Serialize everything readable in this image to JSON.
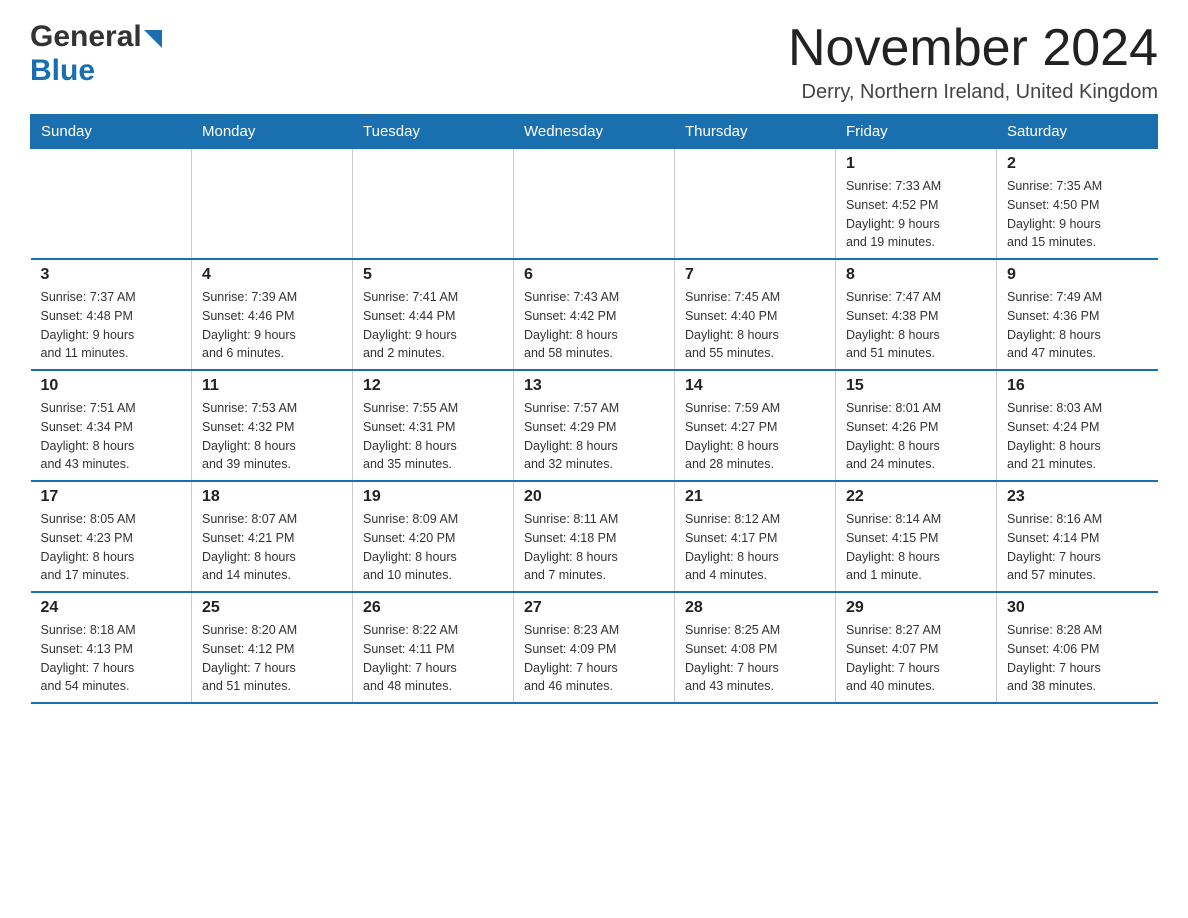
{
  "header": {
    "logo_general": "General",
    "logo_blue": "Blue",
    "month_title": "November 2024",
    "location": "Derry, Northern Ireland, United Kingdom"
  },
  "days_of_week": [
    "Sunday",
    "Monday",
    "Tuesday",
    "Wednesday",
    "Thursday",
    "Friday",
    "Saturday"
  ],
  "weeks": [
    [
      {
        "day": "",
        "info": ""
      },
      {
        "day": "",
        "info": ""
      },
      {
        "day": "",
        "info": ""
      },
      {
        "day": "",
        "info": ""
      },
      {
        "day": "",
        "info": ""
      },
      {
        "day": "1",
        "info": "Sunrise: 7:33 AM\nSunset: 4:52 PM\nDaylight: 9 hours\nand 19 minutes."
      },
      {
        "day": "2",
        "info": "Sunrise: 7:35 AM\nSunset: 4:50 PM\nDaylight: 9 hours\nand 15 minutes."
      }
    ],
    [
      {
        "day": "3",
        "info": "Sunrise: 7:37 AM\nSunset: 4:48 PM\nDaylight: 9 hours\nand 11 minutes."
      },
      {
        "day": "4",
        "info": "Sunrise: 7:39 AM\nSunset: 4:46 PM\nDaylight: 9 hours\nand 6 minutes."
      },
      {
        "day": "5",
        "info": "Sunrise: 7:41 AM\nSunset: 4:44 PM\nDaylight: 9 hours\nand 2 minutes."
      },
      {
        "day": "6",
        "info": "Sunrise: 7:43 AM\nSunset: 4:42 PM\nDaylight: 8 hours\nand 58 minutes."
      },
      {
        "day": "7",
        "info": "Sunrise: 7:45 AM\nSunset: 4:40 PM\nDaylight: 8 hours\nand 55 minutes."
      },
      {
        "day": "8",
        "info": "Sunrise: 7:47 AM\nSunset: 4:38 PM\nDaylight: 8 hours\nand 51 minutes."
      },
      {
        "day": "9",
        "info": "Sunrise: 7:49 AM\nSunset: 4:36 PM\nDaylight: 8 hours\nand 47 minutes."
      }
    ],
    [
      {
        "day": "10",
        "info": "Sunrise: 7:51 AM\nSunset: 4:34 PM\nDaylight: 8 hours\nand 43 minutes."
      },
      {
        "day": "11",
        "info": "Sunrise: 7:53 AM\nSunset: 4:32 PM\nDaylight: 8 hours\nand 39 minutes."
      },
      {
        "day": "12",
        "info": "Sunrise: 7:55 AM\nSunset: 4:31 PM\nDaylight: 8 hours\nand 35 minutes."
      },
      {
        "day": "13",
        "info": "Sunrise: 7:57 AM\nSunset: 4:29 PM\nDaylight: 8 hours\nand 32 minutes."
      },
      {
        "day": "14",
        "info": "Sunrise: 7:59 AM\nSunset: 4:27 PM\nDaylight: 8 hours\nand 28 minutes."
      },
      {
        "day": "15",
        "info": "Sunrise: 8:01 AM\nSunset: 4:26 PM\nDaylight: 8 hours\nand 24 minutes."
      },
      {
        "day": "16",
        "info": "Sunrise: 8:03 AM\nSunset: 4:24 PM\nDaylight: 8 hours\nand 21 minutes."
      }
    ],
    [
      {
        "day": "17",
        "info": "Sunrise: 8:05 AM\nSunset: 4:23 PM\nDaylight: 8 hours\nand 17 minutes."
      },
      {
        "day": "18",
        "info": "Sunrise: 8:07 AM\nSunset: 4:21 PM\nDaylight: 8 hours\nand 14 minutes."
      },
      {
        "day": "19",
        "info": "Sunrise: 8:09 AM\nSunset: 4:20 PM\nDaylight: 8 hours\nand 10 minutes."
      },
      {
        "day": "20",
        "info": "Sunrise: 8:11 AM\nSunset: 4:18 PM\nDaylight: 8 hours\nand 7 minutes."
      },
      {
        "day": "21",
        "info": "Sunrise: 8:12 AM\nSunset: 4:17 PM\nDaylight: 8 hours\nand 4 minutes."
      },
      {
        "day": "22",
        "info": "Sunrise: 8:14 AM\nSunset: 4:15 PM\nDaylight: 8 hours\nand 1 minute."
      },
      {
        "day": "23",
        "info": "Sunrise: 8:16 AM\nSunset: 4:14 PM\nDaylight: 7 hours\nand 57 minutes."
      }
    ],
    [
      {
        "day": "24",
        "info": "Sunrise: 8:18 AM\nSunset: 4:13 PM\nDaylight: 7 hours\nand 54 minutes."
      },
      {
        "day": "25",
        "info": "Sunrise: 8:20 AM\nSunset: 4:12 PM\nDaylight: 7 hours\nand 51 minutes."
      },
      {
        "day": "26",
        "info": "Sunrise: 8:22 AM\nSunset: 4:11 PM\nDaylight: 7 hours\nand 48 minutes."
      },
      {
        "day": "27",
        "info": "Sunrise: 8:23 AM\nSunset: 4:09 PM\nDaylight: 7 hours\nand 46 minutes."
      },
      {
        "day": "28",
        "info": "Sunrise: 8:25 AM\nSunset: 4:08 PM\nDaylight: 7 hours\nand 43 minutes."
      },
      {
        "day": "29",
        "info": "Sunrise: 8:27 AM\nSunset: 4:07 PM\nDaylight: 7 hours\nand 40 minutes."
      },
      {
        "day": "30",
        "info": "Sunrise: 8:28 AM\nSunset: 4:06 PM\nDaylight: 7 hours\nand 38 minutes."
      }
    ]
  ]
}
